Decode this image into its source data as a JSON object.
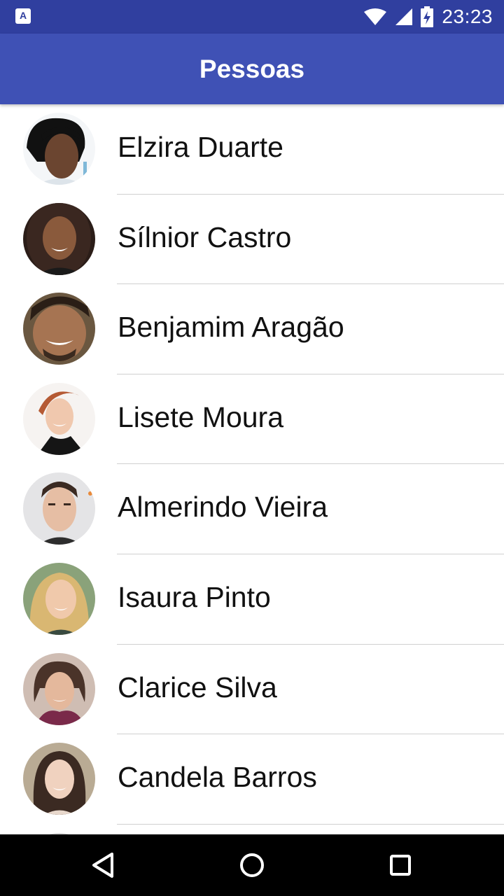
{
  "status_bar": {
    "time": "23:23",
    "notification_icon": "a-badge-icon",
    "icons": [
      "wifi-icon",
      "signal-icon",
      "battery-charging-icon"
    ]
  },
  "app_bar": {
    "title": "Pessoas"
  },
  "people": [
    {
      "name": "Elzira Duarte"
    },
    {
      "name": "Sílnior Castro"
    },
    {
      "name": "Benjamim Aragão"
    },
    {
      "name": "Lisete Moura"
    },
    {
      "name": "Almerindo Vieira"
    },
    {
      "name": "Isaura Pinto"
    },
    {
      "name": "Clarice Silva"
    },
    {
      "name": "Candela Barros"
    }
  ],
  "nav_bar": {
    "icons": [
      "back-icon",
      "home-icon",
      "recents-icon"
    ]
  },
  "colors": {
    "status_bar": "#303f9f",
    "app_bar": "#3f51b5",
    "divider": "#d0d0d0"
  }
}
